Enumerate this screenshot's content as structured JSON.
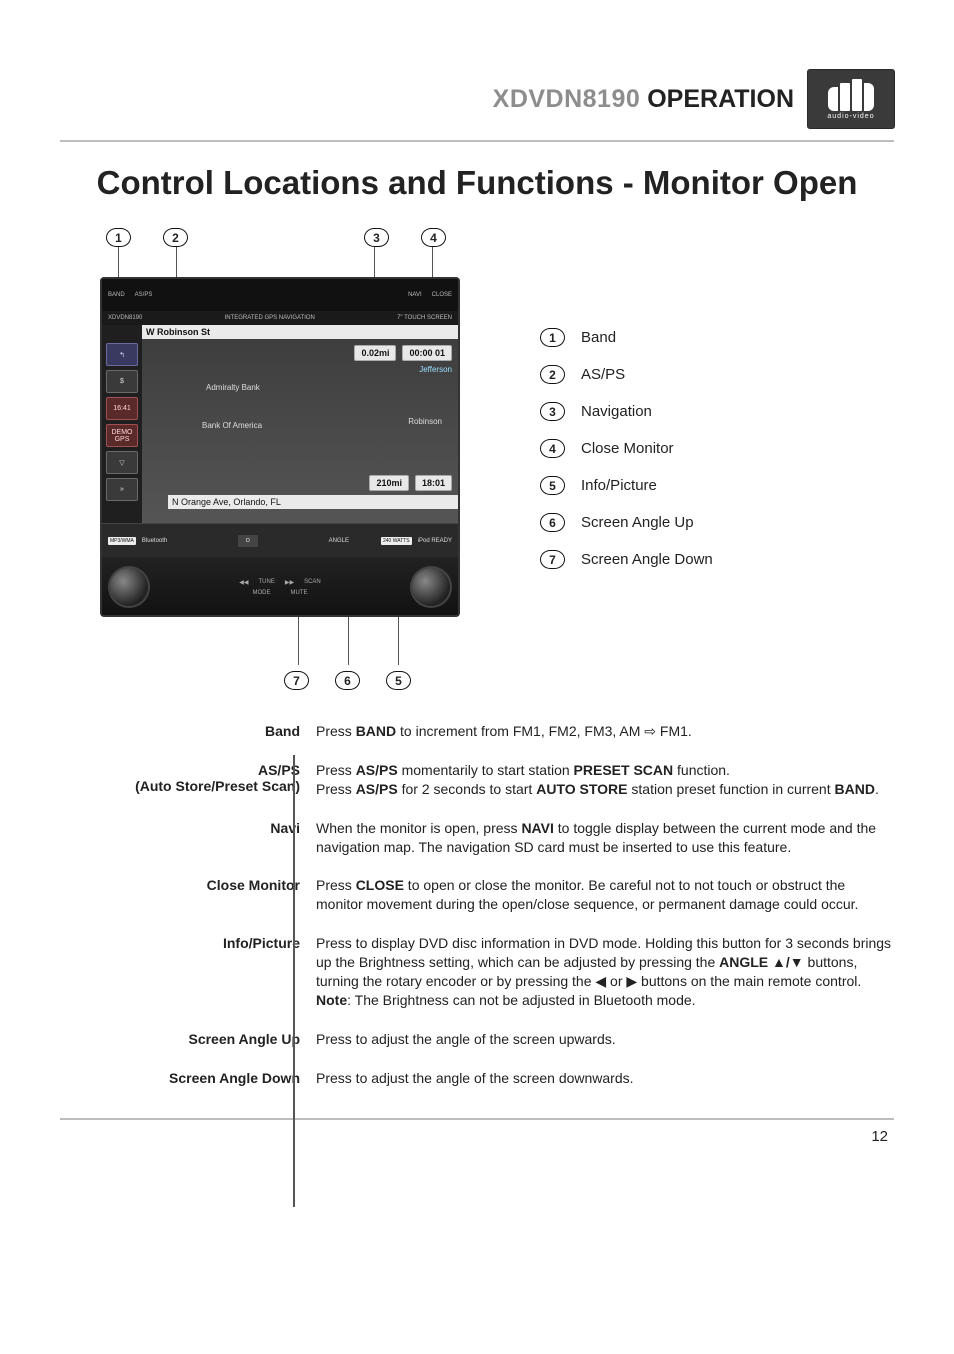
{
  "header": {
    "model": "XDVDN8190",
    "section": "OPERATION",
    "logo_sub": "audio-video"
  },
  "title": "Control Locations and Functions - Monitor Open",
  "device": {
    "btn_band": "BAND",
    "btn_asps": "AS/PS",
    "btn_navi": "NAVI",
    "btn_close": "CLOSE",
    "modelbar_left": "XDVDN8190",
    "modelbar_center": "INTEGRATED GPS NAVIGATION",
    "modelbar_right": "7\" TOUCH SCREEN",
    "street_top": "W Robinson St",
    "dist": "0.02mi",
    "timer": "00:00 01",
    "mid_label": "Jefferson",
    "poi1": "Admiralty Bank",
    "poi2": "Bank Of America",
    "poi3": "Robinson",
    "time_left": "16:41",
    "demo": "DEMO",
    "gps": "GPS",
    "total_dist": "210mi",
    "eta": "18:01",
    "street_bottom": "N Orange Ave, Orlando, FL",
    "feat_mp3": "MP3/WMA",
    "feat_bt": "Bluetooth",
    "feat_240": "240 WATTS",
    "feat_ipod": "iPod READY",
    "base_tune": "TUNE",
    "base_scan": "SCAN",
    "base_mode": "MODE",
    "base_mute": "MUTE",
    "base_angle": "ANGLE"
  },
  "legend": [
    {
      "n": "1",
      "label": "Band"
    },
    {
      "n": "2",
      "label": "AS/PS"
    },
    {
      "n": "3",
      "label": "Navigation"
    },
    {
      "n": "4",
      "label": "Close Monitor"
    },
    {
      "n": "5",
      "label": "Info/Picture"
    },
    {
      "n": "6",
      "label": "Screen Angle Up"
    },
    {
      "n": "7",
      "label": "Screen Angle Down"
    }
  ],
  "top_callouts": [
    "1",
    "2",
    "3",
    "4"
  ],
  "bot_callouts": [
    "7",
    "6",
    "5"
  ],
  "descriptions": [
    {
      "label": "Band",
      "html": "Press <b>BAND</b> to increment from FM1, FM2, FM3, AM ⇨ FM1."
    },
    {
      "label": "AS/PS\n(Auto Store/Preset Scan)",
      "html": "Press <b>AS/PS</b> momentarily to start station <b>PRESET SCAN</b> function.<br>Press <b>AS/PS</b> for 2 seconds to start <b>AUTO STORE</b> station preset function in current <b>BAND</b>."
    },
    {
      "label": "Navi",
      "html": "When the monitor is open, press <b>NAVI</b> to toggle display between the current mode and the navigation map. The navigation SD card must be inserted to use this feature."
    },
    {
      "label": "Close Monitor",
      "html": "Press <b>CLOSE</b> to open or close the monitor. Be careful not to not touch or obstruct the monitor movement during the open/close sequence, or permanent damage could occur."
    },
    {
      "label": "Info/Picture",
      "html": "Press to display DVD disc information in DVD mode. Holding this button for 3 seconds brings up the Brightness setting, which can be adjusted by pressing the <b>ANGLE ▲/▼</b> buttons, turning the rotary encoder or by pressing the ◀ or ▶ buttons on the main remote control. <b>Note</b>: The Brightness can not be adjusted in Bluetooth mode."
    },
    {
      "label": "Screen Angle Up",
      "html": "Press to adjust the angle of the screen upwards."
    },
    {
      "label": "Screen Angle Down",
      "html": "Press to adjust the angle of the screen downwards."
    }
  ],
  "page_number": "12"
}
